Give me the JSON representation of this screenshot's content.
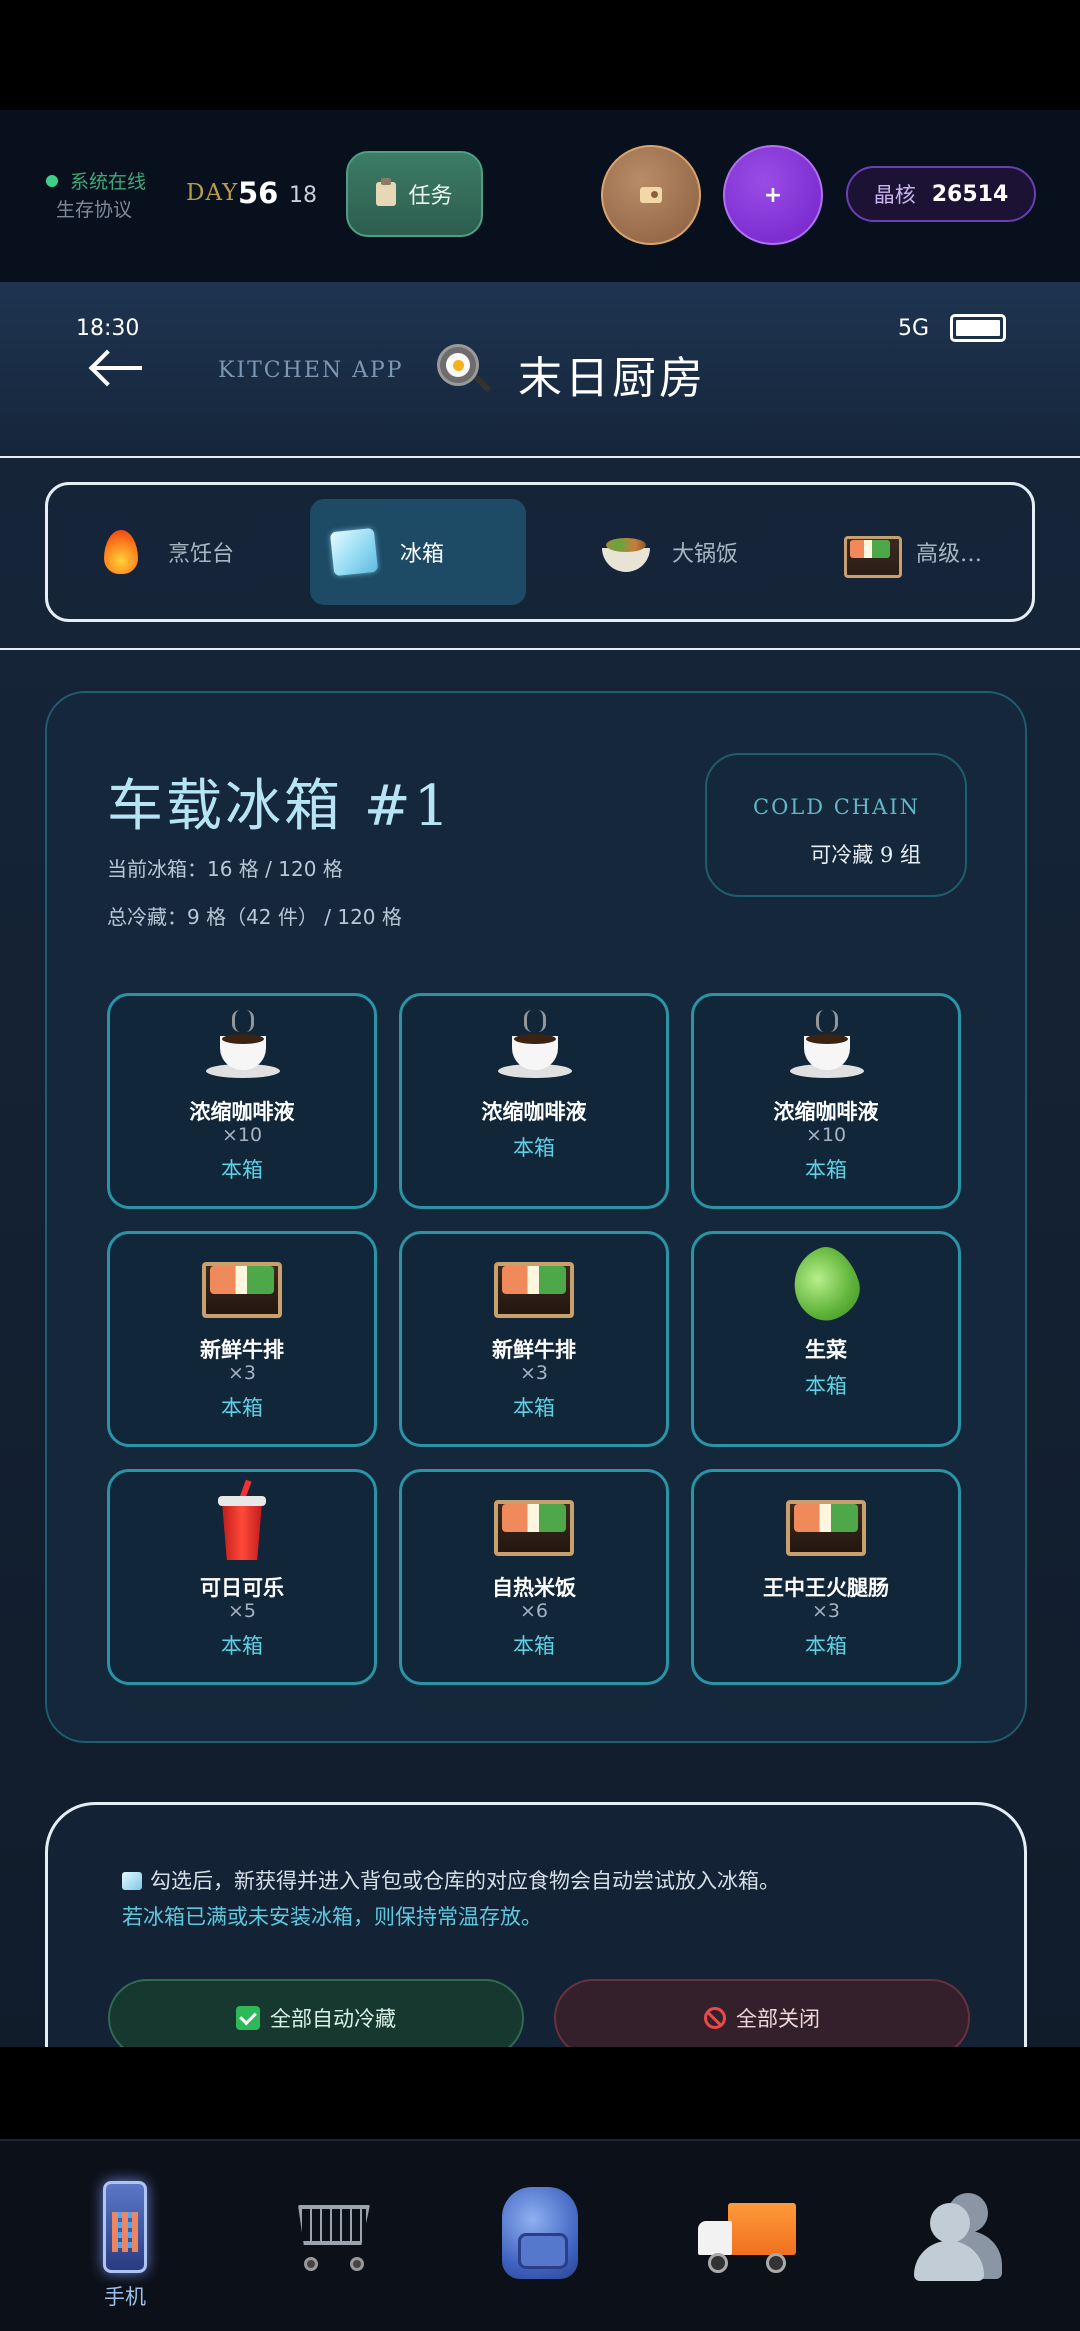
{
  "hud": {
    "online": "系统在线",
    "protocol": "生存协议",
    "day_label": "DAY",
    "day_number": "56",
    "hour": "18",
    "task_label": "任务",
    "plus_label": "+",
    "crystal_label": "晶核",
    "crystal_value": "26514"
  },
  "status_bar": {
    "time": "18:30",
    "network": "5G"
  },
  "header": {
    "kitchen_app": "KITCHEN APP",
    "title": "末日厨房"
  },
  "tabs": [
    {
      "label": "烹饪台",
      "icon": "fire-icon"
    },
    {
      "label": "冰箱",
      "icon": "ice-cube-icon",
      "active": true
    },
    {
      "label": "大锅饭",
      "icon": "bowl-icon"
    },
    {
      "label": "高级…",
      "icon": "bento-icon"
    }
  ],
  "fridge": {
    "title": "车载冰箱 #1",
    "current": "当前冰箱：16 格 / 120 格",
    "total": "总冷藏：9 格（42 件） / 120 格",
    "cold_chain_label": "COLD CHAIN",
    "cold_chain_value": "可冷藏 9 组",
    "items": [
      {
        "name": "浓缩咖啡液",
        "qty": "×10",
        "loc": "本箱",
        "icon": "coffee-icon"
      },
      {
        "name": "浓缩咖啡液",
        "qty": "",
        "loc": "本箱",
        "icon": "coffee-icon"
      },
      {
        "name": "浓缩咖啡液",
        "qty": "×10",
        "loc": "本箱",
        "icon": "coffee-icon"
      },
      {
        "name": "新鲜牛排",
        "qty": "×3",
        "loc": "本箱",
        "icon": "bento-icon"
      },
      {
        "name": "新鲜牛排",
        "qty": "×3",
        "loc": "本箱",
        "icon": "bento-icon"
      },
      {
        "name": "生菜",
        "qty": "",
        "loc": "本箱",
        "icon": "lettuce-icon"
      },
      {
        "name": "可日可乐",
        "qty": "×5",
        "loc": "本箱",
        "icon": "cola-icon"
      },
      {
        "name": "自热米饭",
        "qty": "×6",
        "loc": "本箱",
        "icon": "bento-icon"
      },
      {
        "name": "王中王火腿肠",
        "qty": "×3",
        "loc": "本箱",
        "icon": "bento-icon"
      }
    ]
  },
  "info": {
    "line1": "勾选后，新获得并进入背包或仓库的对应食物会自动尝试放入冰箱。",
    "line2": "若冰箱已满或未安装冰箱，则保持常温存放。",
    "auto_all": "全部自动冷藏",
    "close_all": "全部关闭"
  },
  "bottom_nav": [
    {
      "label": "手机",
      "icon": "phone-icon"
    },
    {
      "label": "",
      "icon": "cart-icon"
    },
    {
      "label": "",
      "icon": "backpack-icon"
    },
    {
      "label": "",
      "icon": "truck-icon"
    },
    {
      "label": "",
      "icon": "people-icon"
    }
  ]
}
